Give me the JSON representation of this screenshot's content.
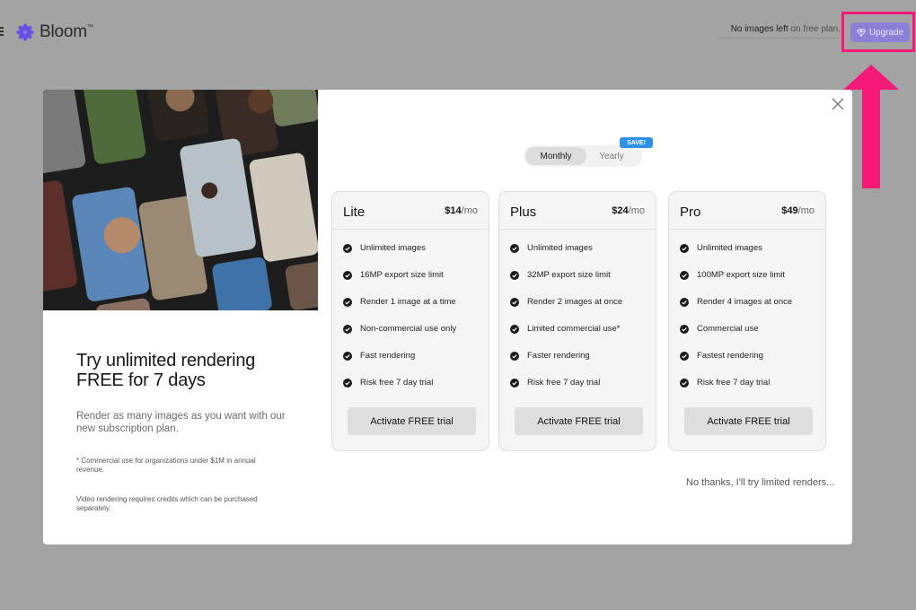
{
  "app": {
    "name": "Bloom",
    "trademark": "™"
  },
  "header": {
    "status_strong": "No images left",
    "status_rest": " on free plan.",
    "upgrade_label": "Upgrade"
  },
  "colors": {
    "accent": "#8b7fd6",
    "highlight": "#f5197a",
    "badge": "#2e90e8",
    "logo": "#6a4fe0"
  },
  "promo": {
    "title": "Try unlimited rendering FREE for 7 days",
    "description": "Render as many images as you want with our new subscription plan.",
    "note_commercial": "* Commercial use for organizations under $1M in annual revenue.",
    "note_video": "Video rendering requires credits which can be purchased separately."
  },
  "billing": {
    "monthly_label": "Monthly",
    "yearly_label": "Yearly",
    "save_badge": "SAVE!",
    "selected": "Monthly"
  },
  "plans": [
    {
      "name": "Lite",
      "price": "$14",
      "period": "/mo",
      "features": [
        "Unlimited images",
        "16MP export size limit",
        "Render 1 image at a time",
        "Non-commercial use only",
        "Fast rendering",
        "Risk free 7 day trial"
      ],
      "cta": "Activate FREE trial"
    },
    {
      "name": "Plus",
      "price": "$24",
      "period": "/mo",
      "features": [
        "Unlimited images",
        "32MP export size limit",
        "Render 2 images at once",
        "Limited commercial use*",
        "Faster rendering",
        "Risk free 7 day trial"
      ],
      "cta": "Activate FREE trial"
    },
    {
      "name": "Pro",
      "price": "$49",
      "period": "/mo",
      "features": [
        "Unlimited images",
        "100MP export size limit",
        "Render 4 images at once",
        "Commercial use",
        "Fastest rendering",
        "Risk free 7 day trial"
      ],
      "cta": "Activate FREE trial"
    }
  ],
  "decline_label": "No thanks, I'll try limited renders...",
  "icons": {
    "menu": "menu-icon",
    "logo": "flower-logo-icon",
    "upgrade": "diamond-icon",
    "close": "close-icon",
    "check": "check-circle-icon",
    "arrow": "arrow-up-icon"
  }
}
